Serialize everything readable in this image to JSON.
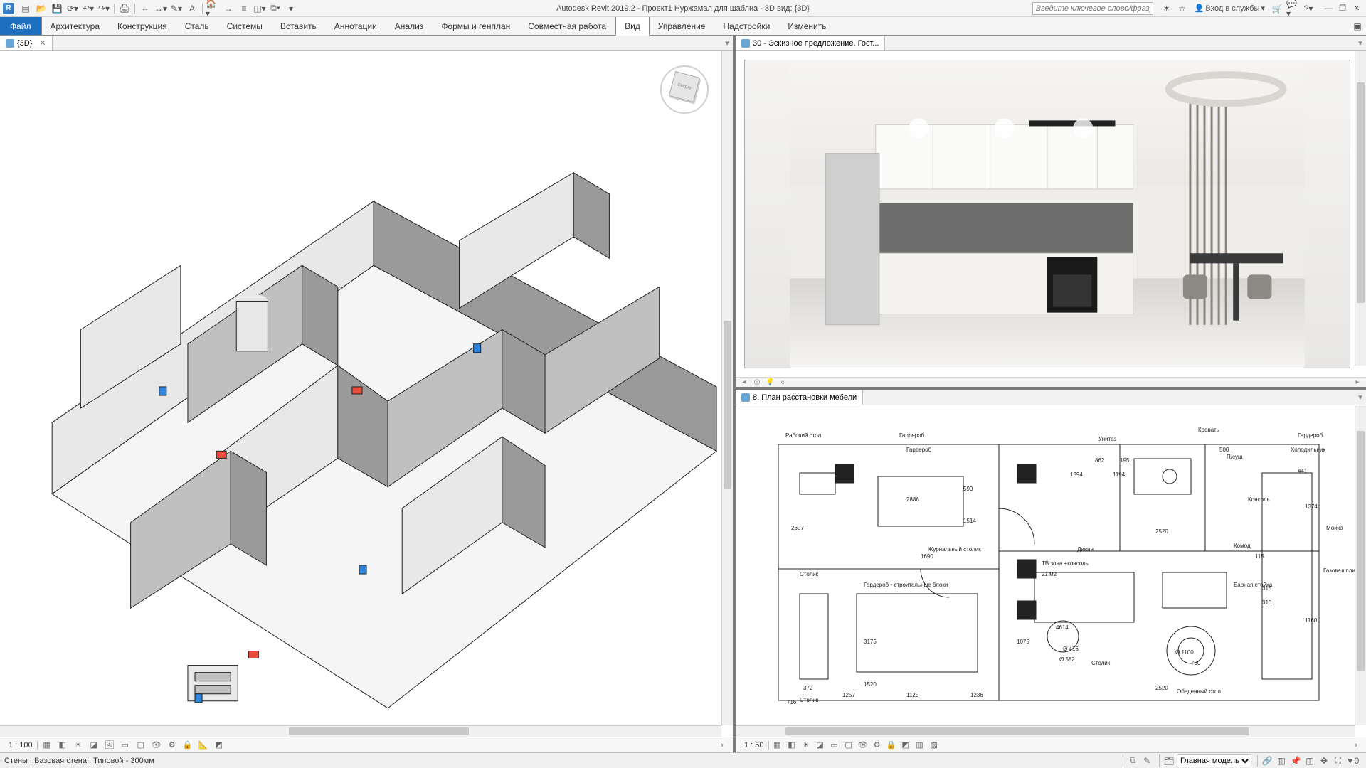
{
  "app": {
    "title": "Autodesk Revit 2019.2 - Проект1 Нуржамал для шаблна - 3D вид: {3D}",
    "search_placeholder": "Введите ключевое слово/фразу",
    "login_label": "Вход в службы"
  },
  "ribbon": {
    "file": "Файл",
    "tabs": [
      "Архитектура",
      "Конструкция",
      "Сталь",
      "Системы",
      "Вставить",
      "Аннотации",
      "Анализ",
      "Формы и генплан",
      "Совместная работа",
      "Вид",
      "Управление",
      "Надстройки",
      "Изменить"
    ],
    "active_index": 9
  },
  "views": {
    "left_tab": "{3D}",
    "right_top_tab": "30 - Эскизное предложение. Гост...",
    "right_bottom_tab": "8. План расстановки мебели"
  },
  "viewcube": {
    "face": "Сверху"
  },
  "plan_labels": {
    "a": "Рабочий стол",
    "b": "Гардероб",
    "c": "Гардероб",
    "d": "Унитаз",
    "e": "Кровать",
    "f": "Холодильник",
    "g": "Консоль",
    "h": "Мойка",
    "i": "Диван",
    "j": "Комод",
    "k": "Газовая плита с духовкой",
    "l": "Барная стойка",
    "m": "ТВ зона +консоль",
    "n": "Журнальный столик",
    "o": "Столик",
    "p": "Обеденный стол",
    "q": "Столик",
    "r": "Гардероб • строительные блоки",
    "s": "Столик",
    "t": "Гардероб",
    "u": "П/суш"
  },
  "plan_dims": {
    "d1": "2886",
    "d2": "1690",
    "d3": "3175",
    "d4": "1520",
    "d5": "1125",
    "d6": "1236",
    "d7": "1075",
    "d8": "4614",
    "d9": "582",
    "d10": "2607",
    "d11": "1514",
    "d12": "590",
    "d13": "1257",
    "d14": "372",
    "d15": "716",
    "d16": "2520",
    "d17": "2520",
    "d18": "1160",
    "d19": "1374",
    "d20": "315",
    "d21": "500",
    "d22": "1394",
    "d23": "1194",
    "d24": "195",
    "d25": "441",
    "d26": "115",
    "d27": "862",
    "d28": "310",
    "d29": "21 м2",
    "d30": "Ø 416",
    "d31": "Ø 582",
    "d32": "Ø 1100",
    "d33": "700"
  },
  "vcb": {
    "left_scale": "1 : 100",
    "right_top_scale": "",
    "right_bottom_scale": "1 : 50"
  },
  "status": {
    "selection": "Стены : Базовая стена : Типовой - 300мм",
    "model_selector": "Главная модель"
  }
}
